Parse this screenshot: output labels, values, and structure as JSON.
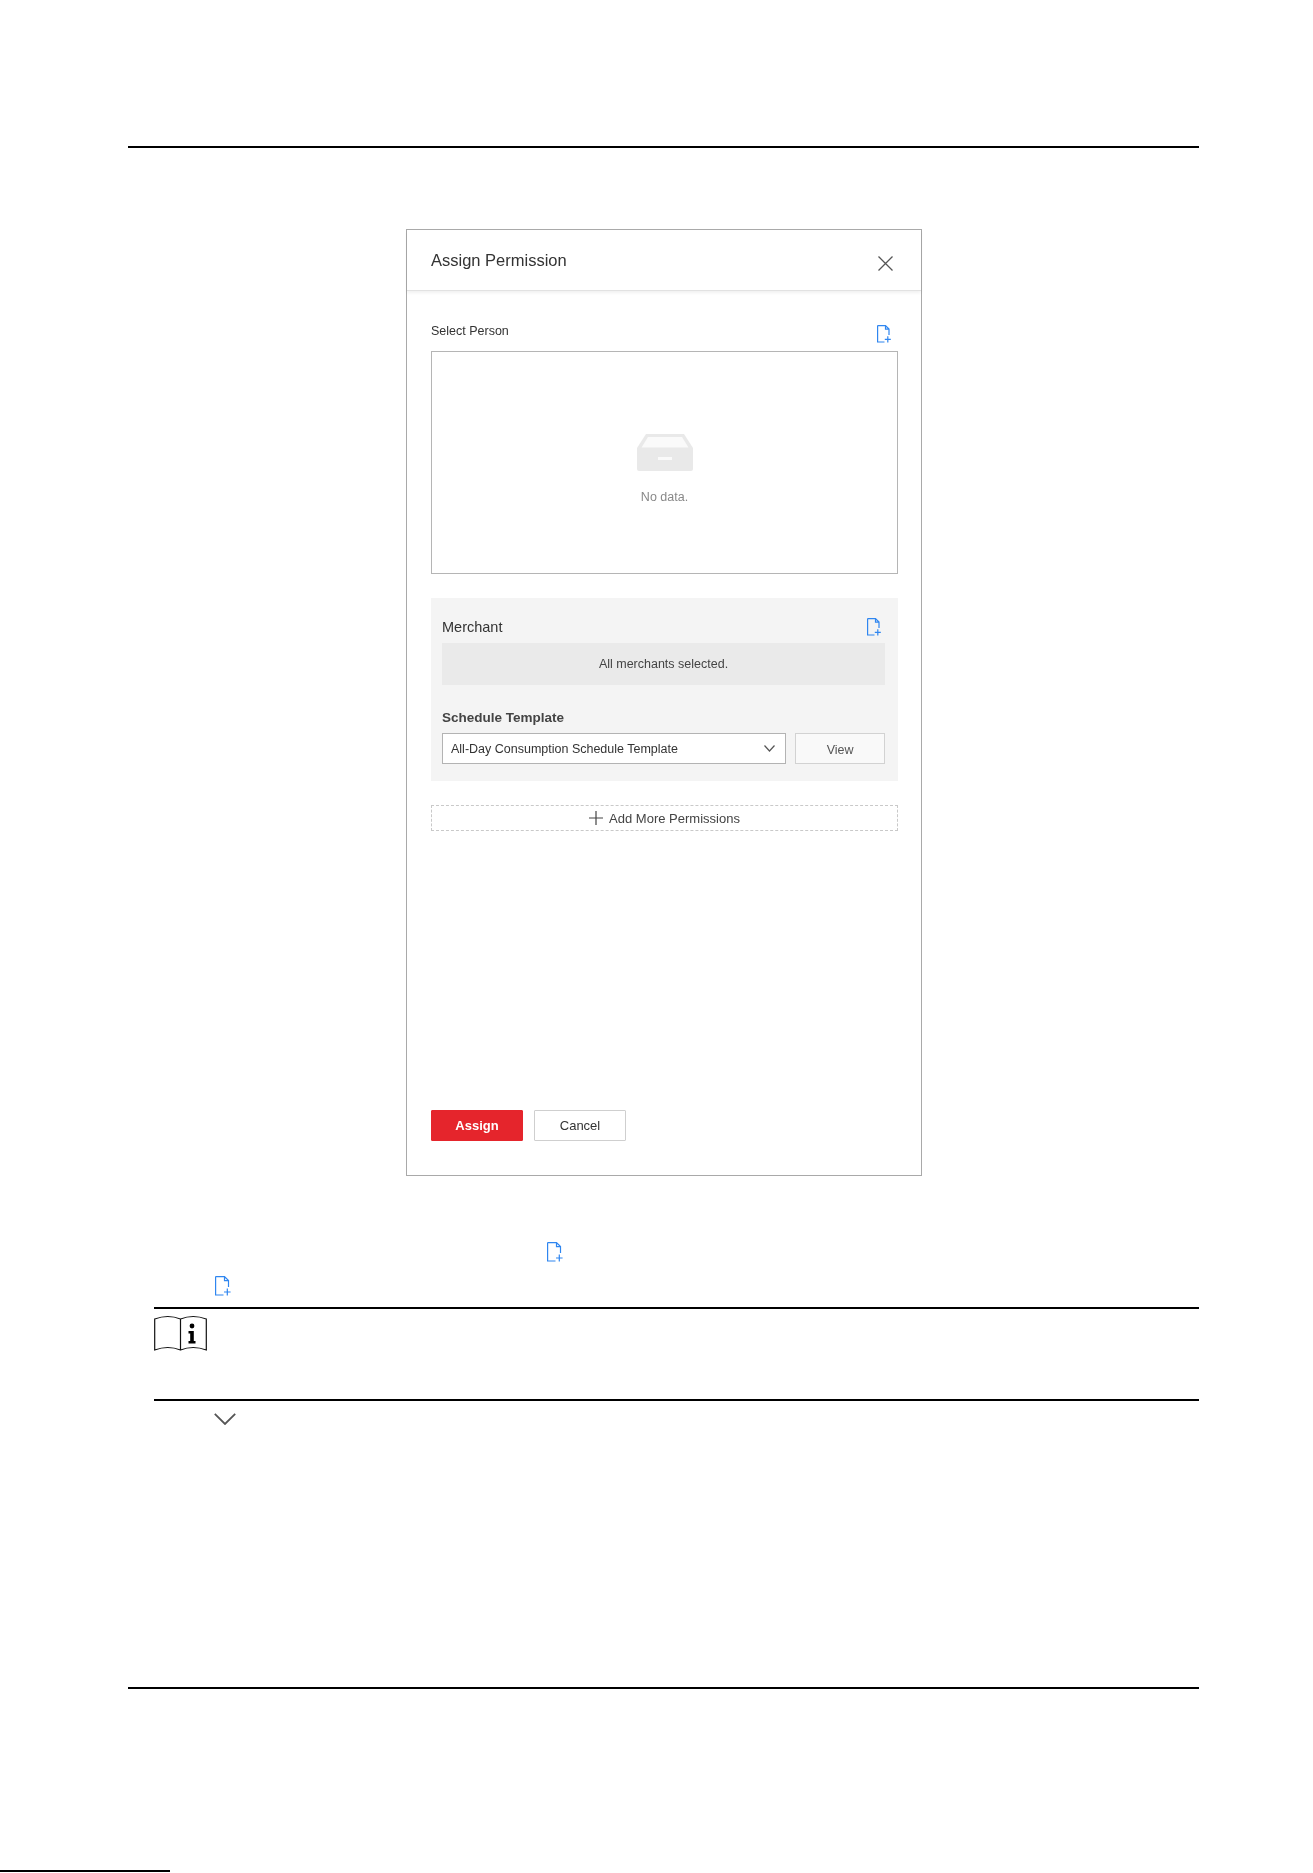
{
  "dialog": {
    "title": "Assign Permission",
    "select_person": {
      "label": "Select Person",
      "empty_text": "No data."
    },
    "permission": {
      "merchant_label": "Merchant",
      "merchant_text": "All merchants selected.",
      "schedule_label": "Schedule Template",
      "schedule_select": {
        "value": "All-Day Consumption Schedule Template"
      },
      "view_button": "View"
    },
    "add_more": "Add More Permissions",
    "buttons": [
      {
        "label": "Assign",
        "kind": "primary"
      },
      {
        "label": "Cancel",
        "kind": "secondary"
      }
    ]
  }
}
